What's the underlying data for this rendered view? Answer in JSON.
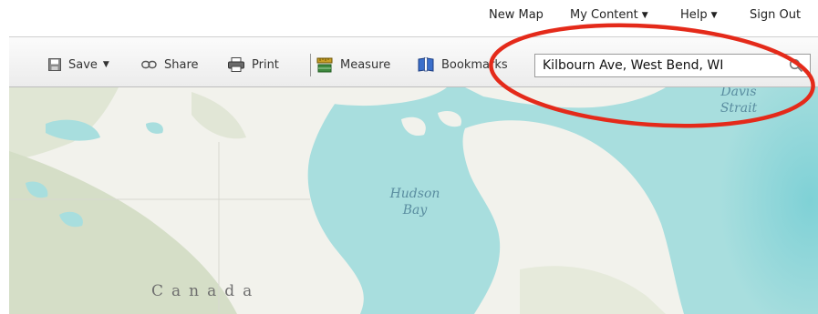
{
  "topnav": {
    "new_map": "New Map",
    "my_content": "My Content",
    "help": "Help",
    "sign_out": "Sign Out"
  },
  "toolbar": {
    "save": "Save",
    "share": "Share",
    "print": "Print",
    "measure": "Measure",
    "bookmarks": "Bookmarks"
  },
  "search": {
    "value": "Kilbourn Ave, West Bend, WI",
    "icon": "search-icon"
  },
  "map": {
    "labels": {
      "hudson_bay_line1": "Hudson",
      "hudson_bay_line2": "Bay",
      "davis_strait_line1": "Davis",
      "davis_strait_line2": "Strait",
      "canada": "Canada"
    }
  },
  "colors": {
    "water": "#a8dede",
    "land_green": "#b8c9a8",
    "land_light": "#f3f3ee",
    "annotation": "#e42a1a"
  }
}
